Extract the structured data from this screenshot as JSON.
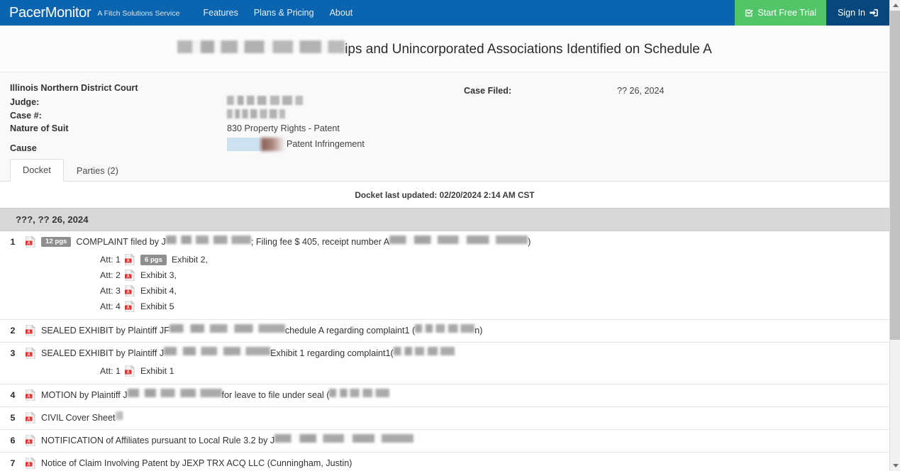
{
  "navbar": {
    "brand": "PacerMonitor",
    "brand_subtitle": "A Fitch Solutions Service",
    "links": [
      {
        "label": "Features"
      },
      {
        "label": "Plans & Pricing"
      },
      {
        "label": "About"
      }
    ],
    "trial_button": "Start Free Trial",
    "trial_icon": "checked-box-icon",
    "trial_color": "#53C569",
    "signin_button": "Sign In",
    "signin_icon": "sign-in-arrow-icon",
    "signin_color": "#07477E",
    "bar_color": "#0A64B0"
  },
  "case_title": {
    "redacted_prefix": "[REDACTED]",
    "visible_suffix": "ips and Unincorporated Associations Identified on Schedule A"
  },
  "case_meta": {
    "court": "Illinois Northern District Court",
    "rows": [
      {
        "label": "Judge:",
        "value": "",
        "redacted": true
      },
      {
        "label": "Case #:",
        "value": "",
        "redacted": true
      },
      {
        "label": "Nature of Suit",
        "value": "830 Property Rights - Patent",
        "redacted": false
      },
      {
        "label": "Cause",
        "value": "Patent Infringement",
        "redacted": false
      }
    ],
    "filed_label": "Case Filed:",
    "filed_value": "?? 26, 2024"
  },
  "tabs": [
    {
      "label": "Docket",
      "active": true
    },
    {
      "label": "Parties (2)",
      "active": false
    }
  ],
  "docket": {
    "last_updated": "Docket last updated: 02/20/2024 2:14 AM CST",
    "date_header": "???, ?? 26, 2024",
    "entries": [
      {
        "number": "1",
        "icon": "pdf-icon",
        "pages_badge": "12 pgs",
        "text_before": "COMPLAINT filed by J",
        "text_middle": "; Filing fee $ 405, receipt number A",
        "text_after": ")",
        "attachments": [
          {
            "att_label": "Att: 1",
            "pages_badge": "6 pgs",
            "text": "Exhibit 2,"
          },
          {
            "att_label": "Att: 2",
            "pages_badge": "",
            "text": "Exhibit 3,"
          },
          {
            "att_label": "Att: 3",
            "pages_badge": "",
            "text": "Exhibit 4,"
          },
          {
            "att_label": "Att: 4",
            "pages_badge": "",
            "text": "Exhibit 5"
          }
        ]
      },
      {
        "number": "2",
        "icon": "pdf-icon",
        "pages_badge": "",
        "text_before": "SEALED EXHIBIT by Plaintiff JF",
        "text_middle": "chedule A regarding complaint1 (",
        "text_after": "n)",
        "attachments": []
      },
      {
        "number": "3",
        "icon": "pdf-icon",
        "pages_badge": "",
        "text_before": "SEALED EXHIBIT by Plaintiff J",
        "text_middle": "Exhibit 1 regarding complaint1(",
        "text_after": "",
        "attachments": [
          {
            "att_label": "Att: 1",
            "pages_badge": "",
            "text": "Exhibit 1"
          }
        ]
      },
      {
        "number": "4",
        "icon": "pdf-icon",
        "pages_badge": "",
        "text_before": "MOTION by Plaintiff J",
        "text_middle": "for leave to file under seal (",
        "text_after": "",
        "attachments": []
      },
      {
        "number": "5",
        "icon": "pdf-icon",
        "pages_badge": "",
        "text_before": "CIVIL Cover Sheet",
        "text_middle": "",
        "text_after": "",
        "attachments": []
      },
      {
        "number": "6",
        "icon": "pdf-icon",
        "pages_badge": "",
        "text_before": "NOTIFICATION of Affiliates pursuant to Local Rule 3.2 by J",
        "text_middle": "",
        "text_after": "",
        "attachments": []
      },
      {
        "number": "7",
        "icon": "pdf-icon",
        "pages_badge": "",
        "text_before": "Notice of Claim Involving Patent by JEXP TRX ACQ LLC (Cunningham, Justin)",
        "text_middle": "",
        "text_after": "",
        "attachments": []
      }
    ]
  },
  "scrollbar": {
    "up_arrow": "scroll-up-arrow-icon",
    "down_arrow": "scroll-down-arrow-icon"
  }
}
